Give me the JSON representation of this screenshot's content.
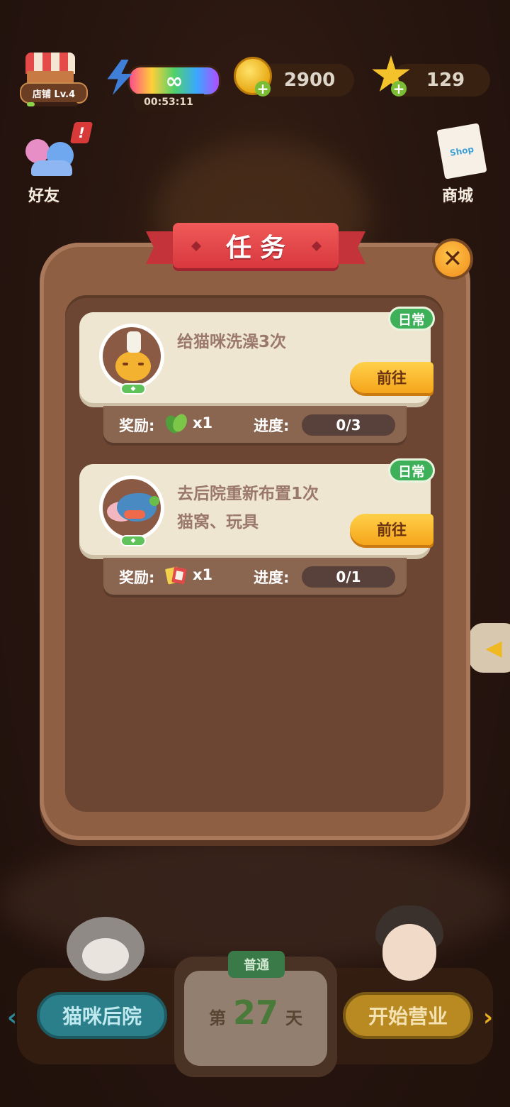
{
  "hud": {
    "shop_level": "店铺 Lv.4",
    "energy_value": "∞",
    "energy_timer": "00:53:11",
    "coins": "2900",
    "stars": "129",
    "plus": "+"
  },
  "side": {
    "friends_label": "好友",
    "friends_alert": "!",
    "mall_label": "商城",
    "shop_text": "Shop"
  },
  "modal": {
    "title": "任务",
    "close_symbol": "✕"
  },
  "tasks": [
    {
      "title": "给猫咪洗澡3次",
      "subtitle": "",
      "tag": "日常",
      "go_label": "前往",
      "reward_label": "奖励:",
      "reward_icon": "leaf-icon",
      "reward_qty": "x1",
      "progress_label": "进度:",
      "progress": "0/3"
    },
    {
      "title": "去后院重新布置1次",
      "subtitle": "猫窝、玩具",
      "tag": "日常",
      "go_label": "前往",
      "reward_label": "奖励:",
      "reward_icon": "card-pack-icon",
      "reward_qty": "x1",
      "progress_label": "进度:",
      "progress": "0/1"
    }
  ],
  "bottom": {
    "backyard_label": "猫咪后院",
    "open_label": "开始营业",
    "mode": "普通",
    "day_prefix": "第",
    "day_number": "27",
    "day_suffix": "天"
  },
  "colors": {
    "ribbon": "#d8383e",
    "daily_tag": "#3fb05a",
    "go_button": "#f5a51a",
    "panel": "#8e5f42"
  }
}
